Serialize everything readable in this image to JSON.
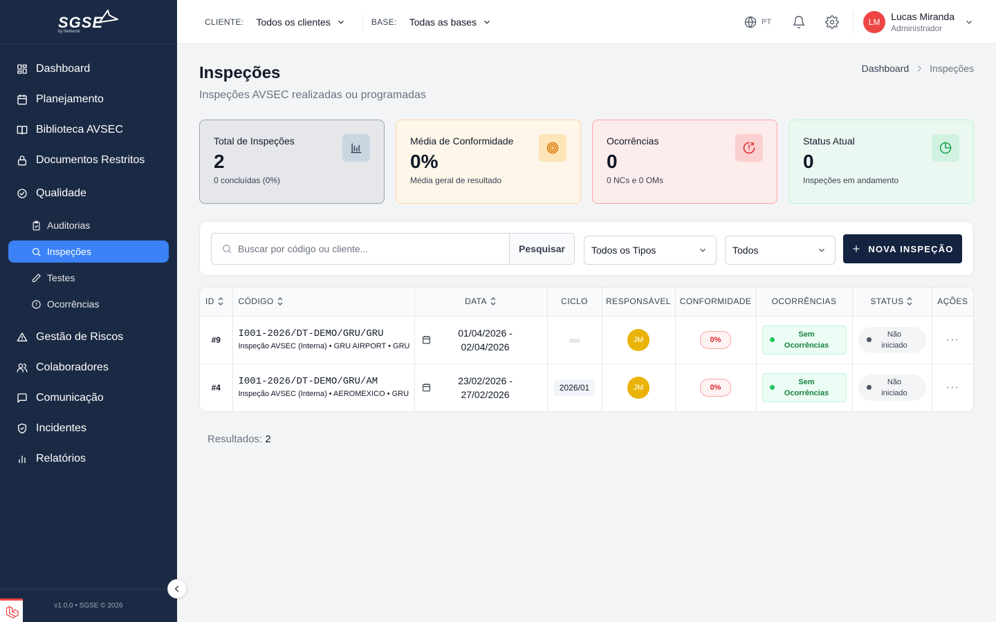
{
  "brand": {
    "name": "SGSE",
    "sub": "by Nettwork"
  },
  "sidebar": {
    "items": [
      {
        "label": "Dashboard",
        "icon": "dashboard-icon"
      },
      {
        "label": "Planejamento",
        "icon": "calendar-icon"
      },
      {
        "label": "Biblioteca AVSEC",
        "icon": "book-icon"
      },
      {
        "label": "Documentos Restritos",
        "icon": "lock-icon"
      },
      {
        "label": "Qualidade",
        "icon": "check-circle-icon"
      }
    ],
    "subitems": [
      {
        "label": "Auditorias",
        "icon": "clipboard-check-icon"
      },
      {
        "label": "Inspeções",
        "icon": "search-icon",
        "active": true
      },
      {
        "label": "Testes",
        "icon": "pencil-icon"
      },
      {
        "label": "Ocorrências",
        "icon": "alert-circle-icon"
      }
    ],
    "items2": [
      {
        "label": "Gestão de Riscos",
        "icon": "warning-triangle-icon"
      },
      {
        "label": "Colaboradores",
        "icon": "users-icon"
      },
      {
        "label": "Comunicação",
        "icon": "message-square-icon"
      },
      {
        "label": "Incidentes",
        "icon": "shield-check-icon"
      },
      {
        "label": "Relatórios",
        "icon": "bar-chart-icon"
      }
    ],
    "footer": "v1.0.0 • SGSE © 2026"
  },
  "header": {
    "client_label": "CLIENTE:",
    "client_value": "Todos os clientes",
    "base_label": "BASE:",
    "base_value": "Todas as bases",
    "language": "PT",
    "user": {
      "initials": "LM",
      "name": "Lucas Miranda",
      "role": "Administrador"
    }
  },
  "page": {
    "title": "Inspeções",
    "subtitle": "Inspeções AVSEC realizadas ou programadas",
    "breadcrumb": {
      "home": "Dashboard",
      "current": "Inspeções"
    }
  },
  "cards": [
    {
      "title": "Total de Inspeções",
      "value": "2",
      "desc": "0 concluídas (0%)",
      "icon": "bar-chart-icon",
      "bg": "#e5e7eb",
      "border": "#9ca3af",
      "icon_bg": "#cbd5e1",
      "icon_color": "#334155"
    },
    {
      "title": "Média de Conformidade",
      "value": "0%",
      "desc": "Média geral de resultado",
      "icon": "target-icon",
      "bg": "#fdf6e9",
      "border": "#fcd9a5",
      "icon_bg": "#fde5b8",
      "icon_color": "#d97706"
    },
    {
      "title": "Ocorrências",
      "value": "0",
      "desc": "0 NCs e 0 OMs",
      "icon": "alert-clock-icon",
      "bg": "#fcecec",
      "border": "#fca5a5",
      "icon_bg": "#fcd0d0",
      "icon_color": "#dc2626"
    },
    {
      "title": "Status Atual",
      "value": "0",
      "desc": "Inspeções em andamento",
      "icon": "pie-chart-icon",
      "bg": "#ebf7f1",
      "border": "#bbf7d0",
      "icon_bg": "#d1f2e1",
      "icon_color": "#16a34a"
    }
  ],
  "filters": {
    "search_placeholder": "Buscar por código ou cliente...",
    "search_button": "Pesquisar",
    "type_select": "Todos os Tipos",
    "status_select": "Todos",
    "new_button": "NOVA INSPEÇÃO"
  },
  "table": {
    "columns": [
      "ID",
      "CÓDIGO",
      "DATA",
      "CICLO",
      "RESPONSÁVEL",
      "CONFORMIDADE",
      "OCORRÊNCIAS",
      "STATUS",
      "AÇÕES"
    ],
    "rows": [
      {
        "id": "#9",
        "code": "I001-2026/DT-DEMO/GRU/GRU",
        "desc": "Inspeção AVSEC (Interna) • GRU AIRPORT • GRU",
        "date_start": "01/04/2026 -",
        "date_end": "02/04/2026",
        "cycle": "",
        "resp": "JM",
        "conformity": "0%",
        "occ_line1": "Sem",
        "occ_line2": "Ocorrências",
        "status_line1": "Não",
        "status_line2": "iniciado",
        "actions": "···"
      },
      {
        "id": "#4",
        "code": "I001-2026/DT-DEMO/GRU/AM",
        "desc": "Inspeção AVSEC (Interna) • AEROMEXICO • GRU",
        "date_start": "23/02/2026 -",
        "date_end": "27/02/2026",
        "cycle": "2026/01",
        "resp": "JM",
        "conformity": "0%",
        "occ_line1": "Sem",
        "occ_line2": "Ocorrências",
        "status_line1": "Não",
        "status_line2": "iniciado",
        "actions": "···"
      }
    ]
  },
  "results": {
    "label": "Resultados:",
    "count": "2"
  }
}
